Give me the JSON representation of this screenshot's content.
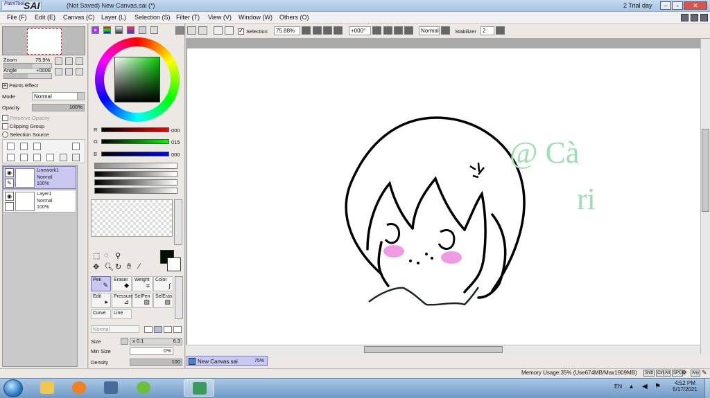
{
  "app": {
    "logo_small": "PaintTool",
    "logo_big": "SAI",
    "window_title": "(Not Saved) New Canvas.sai (*)",
    "trial": "2 Trial day"
  },
  "menu": [
    "File (F)",
    "Edit (E)",
    "Canvas (C)",
    "Layer (L)",
    "Selection (S)",
    "Filter (T)",
    "View (V)",
    "Window (W)",
    "Others (O)"
  ],
  "navigator": {
    "zoom_label": "Zoom",
    "zoom_value": "75.9%",
    "angle_label": "Angle",
    "angle_value": "+0008"
  },
  "layer_panel": {
    "paints_effect": "Paints Effect",
    "mode_label": "Mode",
    "mode_value": "Normal",
    "opacity_label": "Opacity",
    "opacity_value": "100%",
    "opacity_fraction": 1.0,
    "preserve_opacity": "Preserve Opacity",
    "clipping_group": "Clipping Group",
    "selection_source": "Selection Source",
    "layers": [
      {
        "name": "Linework1",
        "mode": "Normal",
        "opacity": "100%",
        "selected": true
      },
      {
        "name": "Layer1",
        "mode": "Normal",
        "opacity": "100%",
        "selected": false
      }
    ]
  },
  "color": {
    "r_label": "R",
    "r_value": "000",
    "g_label": "G",
    "g_value": "015",
    "b_label": "B",
    "b_value": "000",
    "current_color": "#000f00"
  },
  "brush": {
    "tools": [
      {
        "label": "Pen",
        "selected": true
      },
      {
        "label": "Eraser"
      },
      {
        "label": "Weight"
      },
      {
        "label": "Color"
      },
      {
        "label": "Edit"
      },
      {
        "label": "Pressure"
      },
      {
        "label": "SelPen"
      },
      {
        "label": "SelEras"
      },
      {
        "label": "Curve"
      },
      {
        "label": "Line"
      }
    ],
    "blend_mode": "Normal",
    "size_label": "Size",
    "size_mult": "x 0.1",
    "size_value": "6.3",
    "minsize_label": "Min Size",
    "minsize_value": "0%",
    "density_label": "Density",
    "density_value": "100"
  },
  "toolbar": {
    "selection_label": "Selection",
    "zoom": "75.88%",
    "angle": "+000°",
    "mode": "Normal",
    "stabilizer_label": "Stabilizer",
    "stabilizer_value": "2"
  },
  "canvas_text": {
    "line1": "@ Cà",
    "line2": "ri",
    "ink_color": "#9de0b0",
    "blush_color": "#ef9be3"
  },
  "document_tab": {
    "name": "New Canvas.sai",
    "zoom": "75%"
  },
  "status": {
    "memory": "Memory Usage:35% (Use674MB/Max1909MB)",
    "keys": [
      "Shift",
      "Ctrl",
      "Alt",
      "SPC",
      "Any"
    ]
  },
  "taskbar": {
    "language": "EN",
    "time": "4:52 PM",
    "date": "5/17/2021"
  }
}
